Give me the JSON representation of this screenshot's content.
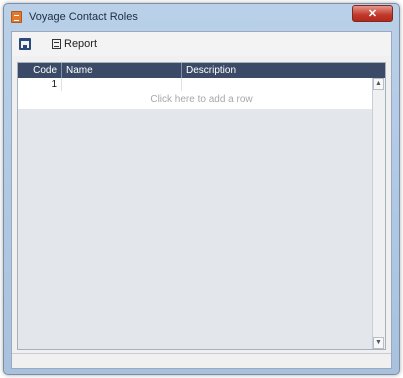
{
  "window": {
    "title": "Voyage Contact Roles",
    "close_glyph": "✕"
  },
  "toolbar": {
    "save_icon": "save-icon",
    "report_label": "Report",
    "report_icon": "report-icon"
  },
  "grid": {
    "columns": [
      "Code",
      "Name",
      "Description"
    ],
    "rows": [
      {
        "code": "1",
        "name": "",
        "description": ""
      }
    ],
    "add_row_text": "Click here to add a row"
  },
  "scrollbar": {
    "up_glyph": "▲",
    "down_glyph": "▼"
  },
  "colors": {
    "header_bg": "#3b4a66",
    "close_button": "#c1382a",
    "title_bar": "#b9d0e8"
  }
}
